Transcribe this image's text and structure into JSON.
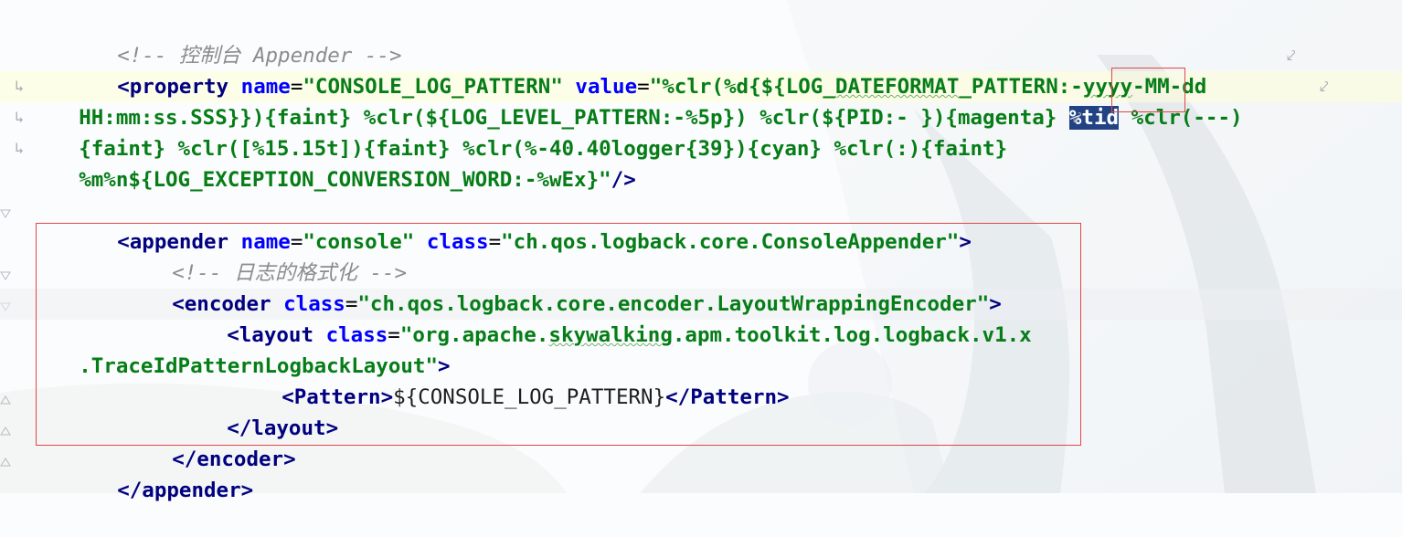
{
  "lines": [
    {
      "comment": "<!-- 控制台 Appender -->"
    },
    {
      "tag_open": "<property",
      "attr_name": "name",
      "attr_name_value": "\"CONSOLE_LOG_PATTERN\"",
      "attr_value": "value",
      "value_part1": "\"%clr(%d{${LOG_",
      "value_part1_wavy": "DATEFORMAT",
      "value_part1_tail": "_PATTERN:-",
      "value_part1_wavy2": "yyyy",
      "value_part1_end": "-MM-dd"
    },
    {
      "value_part2a": "HH:mm:ss.SSS}}){faint} %clr(${LOG_LEVEL_PATTERN:-%5p}) %clr(${PID:- }){magenta} ",
      "selected": "%tid",
      "value_part2b": " %clr(---)"
    },
    {
      "value_part3": "{faint} %clr([%15.15t]){faint} %clr(%-40.40logger{39}){cyan} %clr(:){faint} "
    },
    {
      "value_part4": "%m%n${LOG_EXCEPTION_CONVERSION_WORD:-%wEx}\"",
      "close": "/>"
    },
    {},
    {
      "open": "<",
      "tag": "appender",
      "attr1": "name",
      "val1": "\"console\"",
      "attr2": "class",
      "val2": "\"ch.qos.logback.core.ConsoleAppender\"",
      "close": ">"
    },
    {
      "comment": "<!-- 日志的格式化 -->"
    },
    {
      "open": "<",
      "tag": "encoder",
      "attr": "class",
      "val": "\"ch.qos.logback.core.encoder.LayoutWrappingEncoder\"",
      "close": ">"
    },
    {
      "open": "<",
      "tag": "layout",
      "attr": "class",
      "val_a": "\"org.apache.",
      "val_wavy": "skywalking",
      "val_b": ".apm.toolkit.log.logback.v1.x"
    },
    {
      "val_cont": ".TraceIdPatternLogbackLayout\"",
      "close": ">"
    },
    {
      "open": "<",
      "tag": "Pattern",
      "close": ">",
      "text": "${CONSOLE_LOG_PATTERN}",
      "end_open": "</",
      "end_tag": "Pattern",
      "end_close": ">"
    },
    {
      "open": "</",
      "tag": "layout",
      "close": ">"
    },
    {
      "open": "</",
      "tag": "encoder",
      "close": ">"
    },
    {
      "open": "</",
      "tag": "appender",
      "close": ">"
    }
  ],
  "icons": {
    "soft_wrap": "soft-wrap-icon",
    "wrap_continuation": "wrap-continuation-icon",
    "fold": "fold-icon"
  },
  "colors": {
    "tag": "#000080",
    "attribute": "#0000ff",
    "string": "#067d17",
    "comment": "#8c8c8c",
    "selection": "#214283",
    "annotation_box": "#e14646"
  }
}
